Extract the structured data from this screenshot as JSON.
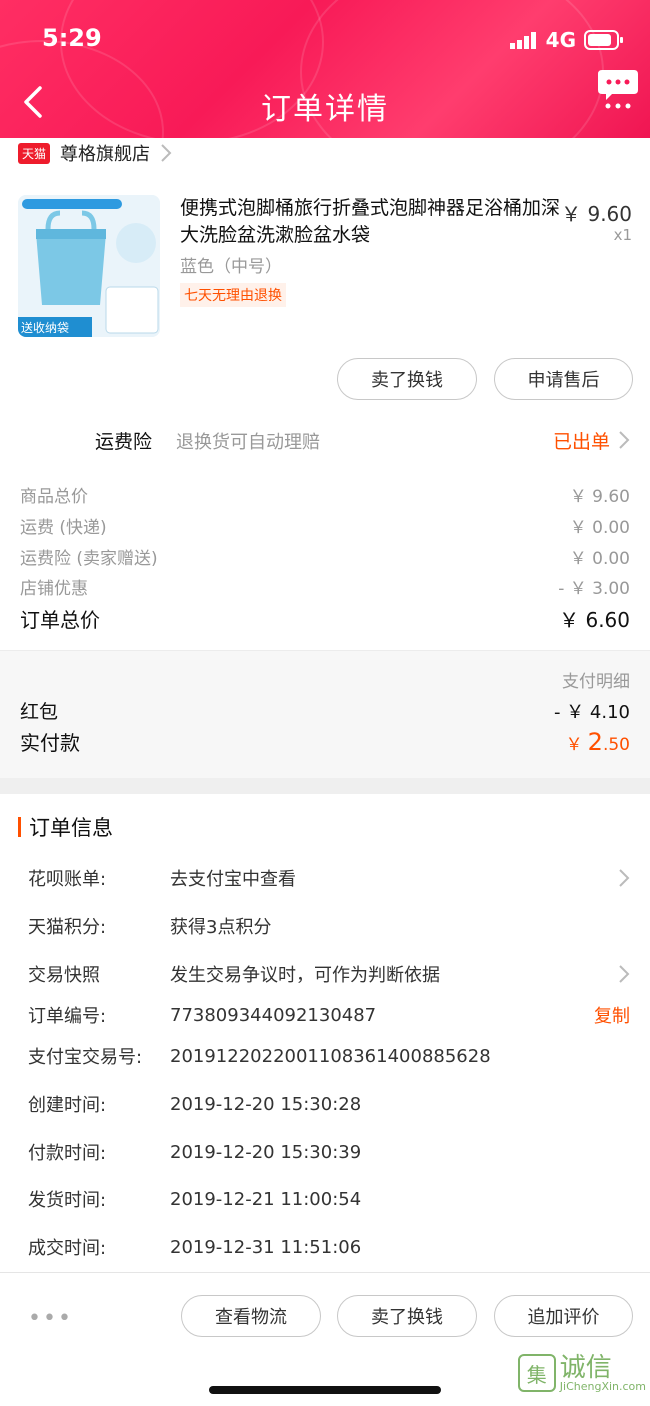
{
  "status_bar": {
    "time": "5:29",
    "network": "4G"
  },
  "nav": {
    "title": "订单详情"
  },
  "shop": {
    "badge": "天猫",
    "name": "尊格旗舰店"
  },
  "product": {
    "title": "便携式泡脚桶旅行折叠式泡脚神器足浴桶加深大洗脸盆洗漱脸盆水袋",
    "price": "￥ 9.60",
    "qty": "x1",
    "sku": "蓝色（中号）",
    "tag": "七天无理由退换",
    "image_text": "送收纳袋"
  },
  "product_actions": {
    "sell": "卖了换钱",
    "after_sale": "申请售后"
  },
  "insurance": {
    "label": "运费险",
    "desc": "退换货可自动理赔",
    "status": "已出单"
  },
  "fees": [
    {
      "label": "商品总价",
      "value": "￥ 9.60"
    },
    {
      "label": "运费 (快递)",
      "value": "￥ 0.00"
    },
    {
      "label": "运费险 (卖家赠送)",
      "value": "￥ 0.00"
    },
    {
      "label": "店铺优惠",
      "value": "- ￥ 3.00"
    }
  ],
  "order_total": {
    "label": "订单总价",
    "value": "￥ 6.60"
  },
  "payment": {
    "detail_label": "支付明细",
    "redpacket_label": "红包",
    "redpacket_value": "- ￥ 4.10",
    "paid_label": "实付款",
    "paid_currency": "￥",
    "paid_int": "2",
    "paid_dec": ".50"
  },
  "order_info": {
    "title": "订单信息",
    "rows": [
      {
        "key": "花呗账单:",
        "value": "去支付宝中查看"
      },
      {
        "key": "天猫积分:",
        "value": "获得3点积分"
      },
      {
        "key": "交易快照",
        "value": "发生交易争议时，可作为判断依据"
      },
      {
        "key": "订单编号:",
        "value": "773809344092130487"
      },
      {
        "key": "支付宝交易号:",
        "value": "2019122022001108361400885628"
      },
      {
        "key": "创建时间:",
        "value": "2019-12-20 15:30:28"
      },
      {
        "key": "付款时间:",
        "value": "2019-12-20 15:30:39"
      },
      {
        "key": "发货时间:",
        "value": "2019-12-21 11:00:54"
      },
      {
        "key": "成交时间:",
        "value": "2019-12-31 11:51:06"
      }
    ],
    "copy_label": "复制"
  },
  "footer": {
    "more": "•••",
    "logistics": "查看物流",
    "sell": "卖了换钱",
    "review": "追加评价"
  },
  "watermark": {
    "cn": "诚信",
    "en": "JiChengXin.com",
    "logo_char": "集"
  },
  "colors": {
    "header": "#f81a57",
    "accent": "#ff5000"
  }
}
